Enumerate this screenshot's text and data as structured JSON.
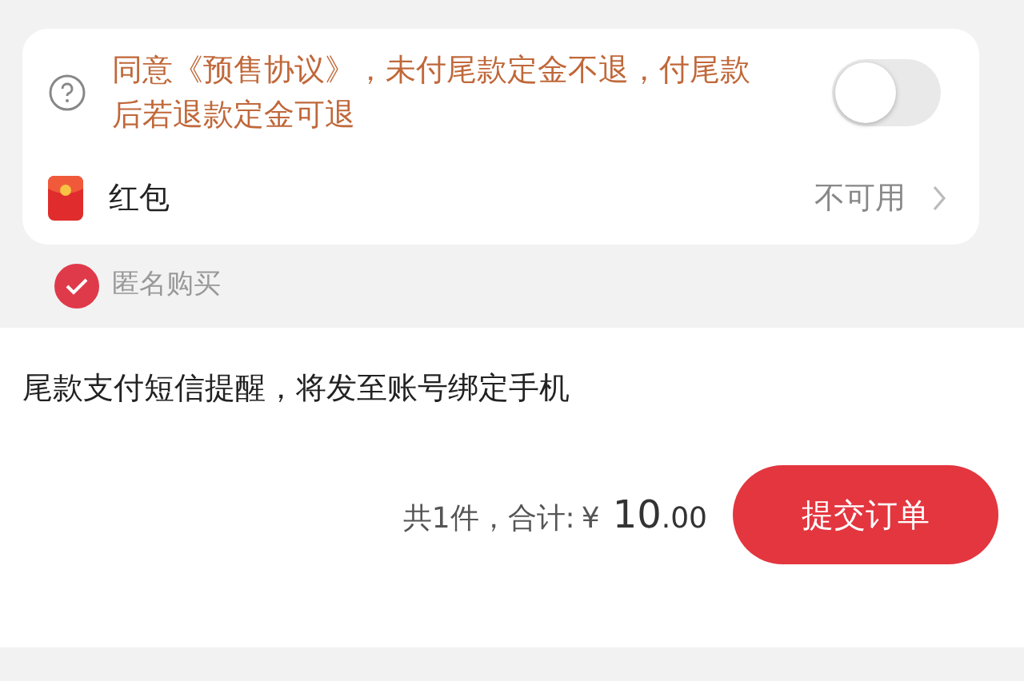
{
  "agreement": {
    "text": "同意《预售协议》，未付尾款定金不退，付尾款后若退款定金可退",
    "on": false
  },
  "red_packet": {
    "label": "红包",
    "value": "不可用"
  },
  "anonymous": {
    "label": "匿名购买",
    "checked": true
  },
  "notice": "尾款支付短信提醒，将发至账号绑定手机",
  "summary": {
    "count": "共1件，",
    "total_label": "合计:",
    "currency": "¥",
    "amount": "10",
    "decimals": ".00"
  },
  "submit_button": "提交订单"
}
